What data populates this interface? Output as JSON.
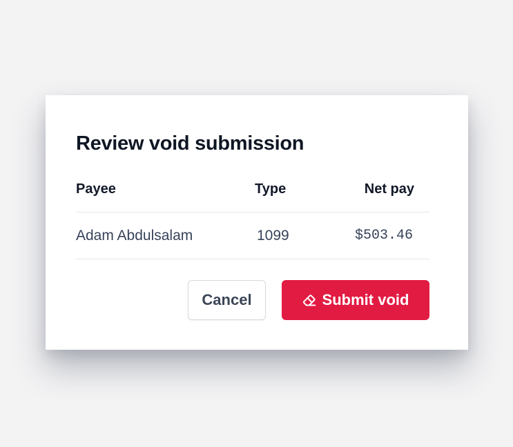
{
  "dialog": {
    "title": "Review void submission",
    "columns": {
      "payee": "Payee",
      "type": "Type",
      "net_pay": "Net pay"
    },
    "rows": [
      {
        "payee": "Adam Abdulsalam",
        "type": "1099",
        "net_pay": "$503.46"
      }
    ],
    "actions": {
      "cancel_label": "Cancel",
      "submit_label": "Submit void",
      "submit_icon": "eraser-icon"
    }
  },
  "colors": {
    "page_bg": "#f3f3f4",
    "modal_bg": "#ffffff",
    "submit_bg": "#e21b43",
    "title_text": "#0f1623",
    "body_text": "#374259"
  }
}
